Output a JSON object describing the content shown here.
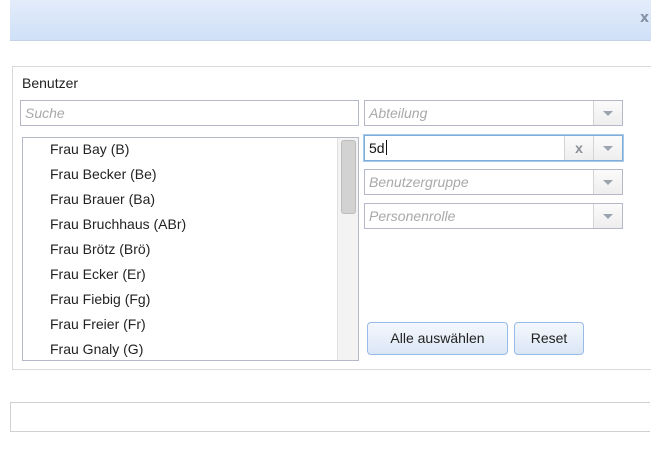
{
  "window": {
    "close_label": "x"
  },
  "group": {
    "legend": "Benutzer"
  },
  "search": {
    "placeholder": "Suche",
    "value": ""
  },
  "filters": {
    "department": {
      "placeholder": "Abteilung"
    },
    "text_filter": {
      "value": "5d",
      "clear_icon": "x"
    },
    "user_group": {
      "placeholder": "Benutzergruppe"
    },
    "person_role": {
      "placeholder": "Personenrolle"
    }
  },
  "users": [
    "Frau Bay (B)",
    "Frau Becker (Be)",
    "Frau Brauer (Ba)",
    "Frau Bruchhaus (ABr)",
    "Frau Brötz (Brö)",
    "Frau Ecker (Er)",
    "Frau Fiebig (Fg)",
    "Frau Freier (Fr)",
    "Frau Gnaly (G)"
  ],
  "buttons": {
    "select_all": "Alle auswählen",
    "reset": "Reset"
  },
  "colors": {
    "titlebar": "#cfe0f8",
    "button_border": "#99bbe8",
    "focus": "#7eadd9"
  }
}
